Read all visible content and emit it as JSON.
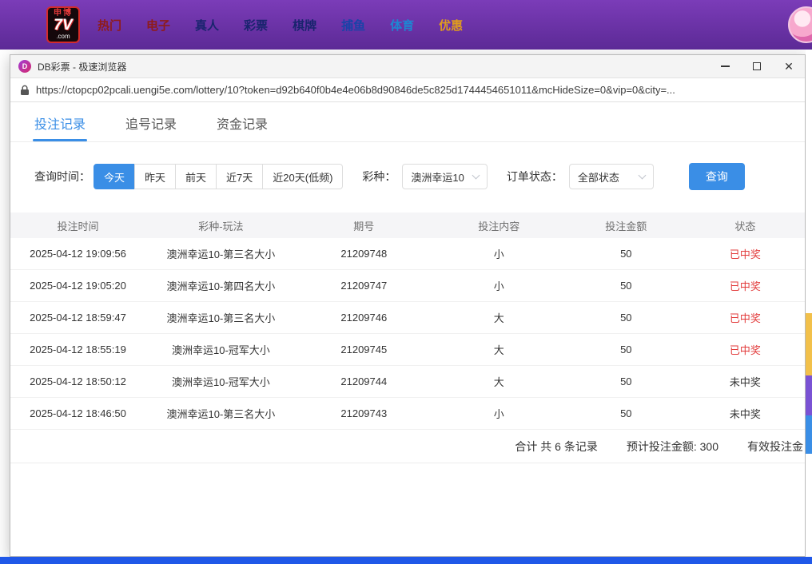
{
  "colors": {
    "accent": "#3a8ee6",
    "win_red": "#e23b3b",
    "topbar_light": "#7b3cb8",
    "topbar_dark": "#5c2a96",
    "bottom_blue": "#2058e8"
  },
  "top_nav": {
    "logo": {
      "line1": "申博",
      "line2": "7V",
      "line3": ".com"
    },
    "items": [
      {
        "label": "热门",
        "color": "#8e1b1b"
      },
      {
        "label": "电子",
        "color": "#8e1b1b"
      },
      {
        "label": "真人",
        "color": "#19246e"
      },
      {
        "label": "彩票",
        "color": "#19246e"
      },
      {
        "label": "棋牌",
        "color": "#19246e"
      },
      {
        "label": "捕鱼",
        "color": "#1843a8"
      },
      {
        "label": "体育",
        "color": "#1e86d2"
      },
      {
        "label": "优惠",
        "color": "#df9c1e"
      }
    ]
  },
  "browser": {
    "title": "DB彩票 - 极速浏览器",
    "app_icon_letter": "D",
    "url": "https://ctopcp02pcali.uengi5e.com/lottery/10?token=d92b640f0b4e4e06b8d90846de5c825d1744454651011&mcHideSize=0&vip=0&city=...",
    "close_glyph": "✕"
  },
  "tabs": [
    {
      "label": "投注记录",
      "active": true
    },
    {
      "label": "追号记录",
      "active": false
    },
    {
      "label": "资金记录",
      "active": false
    }
  ],
  "filters": {
    "time_label": "查询时间：",
    "time_options": [
      {
        "label": "今天",
        "active": true
      },
      {
        "label": "昨天",
        "active": false
      },
      {
        "label": "前天",
        "active": false
      },
      {
        "label": "近7天",
        "active": false
      },
      {
        "label": "近20天(低频)",
        "active": false
      }
    ],
    "lottery_label": "彩种：",
    "lottery_value": "澳洲幸运10",
    "status_label": "订单状态：",
    "status_value": "全部状态",
    "search_button": "查询"
  },
  "table": {
    "headers": [
      "投注时间",
      "彩种-玩法",
      "期号",
      "投注内容",
      "投注金额",
      "状态"
    ],
    "rows": [
      {
        "time": "2025-04-12 19:09:56",
        "game": "澳洲幸运10-第三名大小",
        "issue": "21209748",
        "content": "小",
        "amount": "50",
        "status": "已中奖",
        "won": true
      },
      {
        "time": "2025-04-12 19:05:20",
        "game": "澳洲幸运10-第四名大小",
        "issue": "21209747",
        "content": "小",
        "amount": "50",
        "status": "已中奖",
        "won": true
      },
      {
        "time": "2025-04-12 18:59:47",
        "game": "澳洲幸运10-第三名大小",
        "issue": "21209746",
        "content": "大",
        "amount": "50",
        "status": "已中奖",
        "won": true
      },
      {
        "time": "2025-04-12 18:55:19",
        "game": "澳洲幸运10-冠军大小",
        "issue": "21209745",
        "content": "大",
        "amount": "50",
        "status": "已中奖",
        "won": true
      },
      {
        "time": "2025-04-12 18:50:12",
        "game": "澳洲幸运10-冠军大小",
        "issue": "21209744",
        "content": "大",
        "amount": "50",
        "status": "未中奖",
        "won": false
      },
      {
        "time": "2025-04-12 18:46:50",
        "game": "澳洲幸运10-第三名大小",
        "issue": "21209743",
        "content": "小",
        "amount": "50",
        "status": "未中奖",
        "won": false
      }
    ],
    "summary": {
      "total": "合计 共 6 条记录",
      "expected": "预计投注金额: 300",
      "valid": "有效投注金"
    }
  }
}
